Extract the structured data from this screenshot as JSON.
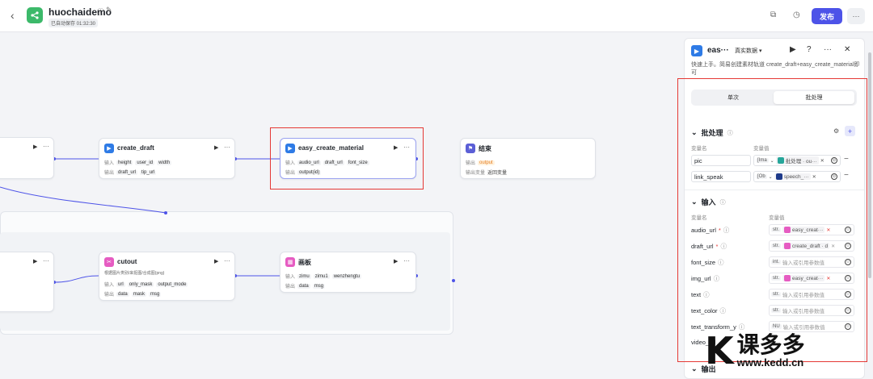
{
  "topbar": {
    "back_icon": "chevron-left-icon",
    "app_title": "huochaidemo",
    "autosave": "已自动保存 01:32:30",
    "publish_label": "发布",
    "more_label": "···"
  },
  "nodes": {
    "create_draft": {
      "title": "create_draft",
      "in_label": "输入",
      "inputs": [
        "height",
        "user_id",
        "width"
      ],
      "out_label": "输出",
      "outputs": [
        "draft_url",
        "tip_url"
      ]
    },
    "easy_create_material": {
      "title": "easy_create_material",
      "in_label": "输入",
      "inputs": [
        "audio_url",
        "draft_url",
        "font_size"
      ],
      "out_label": "输出",
      "outputs": [
        "output(id)"
      ]
    },
    "end": {
      "title": "结束",
      "out_label": "输出",
      "output": "output",
      "out_var_label": "输出变量",
      "out_var_value": "返回变量"
    },
    "cutout": {
      "title": "cutout",
      "desc": "根据图片类别/来抠图/合成图(png)",
      "in_label": "输入",
      "inputs": [
        "url",
        "only_mask",
        "output_mode"
      ],
      "out_label": "输出",
      "outputs": [
        "data",
        "mask",
        "msg"
      ]
    },
    "canvas": {
      "title": "画板",
      "in_label": "输入",
      "inputs": [
        "zimu",
        "zimu1",
        "wenzhengtu"
      ],
      "out_label": "输出",
      "outputs": [
        "data",
        "msg"
      ]
    }
  },
  "panel": {
    "title": "eas···",
    "mode": "真实数据 ▾",
    "desc": "快速上手。简易创建素材轨道 create_draft+easy_create_material即可",
    "tabs": [
      "单次",
      "批处理"
    ],
    "batch_title": "批处理",
    "col_var_name": "变量名",
    "col_var_value": "变量值",
    "batch_vars": [
      {
        "name": "pic",
        "type": "[Ima",
        "chip": "批处理 · ou···",
        "color": "#26a69a"
      },
      {
        "name": "link_speak",
        "type": "[Ob",
        "chip": "speech_···",
        "color": "#1e3a8a"
      }
    ],
    "input_title": "输入",
    "inputs": [
      {
        "name": "audio_url",
        "required": "*",
        "type": "str.",
        "chip": "easy_creat···",
        "placeholder": ""
      },
      {
        "name": "draft_url",
        "required": "*",
        "type": "str.",
        "chip": "create_draft · d",
        "placeholder": ""
      },
      {
        "name": "font_size",
        "required": "",
        "type": "int.",
        "chip": "",
        "placeholder": "输入或引用参数值"
      },
      {
        "name": "img_url",
        "required": "",
        "type": "str.",
        "chip": "easy_creat···",
        "placeholder": ""
      },
      {
        "name": "text",
        "required": "",
        "type": "str.",
        "chip": "",
        "placeholder": "输入或引用参数值"
      },
      {
        "name": "text_color",
        "required": "",
        "type": "str.",
        "chip": "",
        "placeholder": "输入或引用参数值"
      },
      {
        "name": "text_transform_y",
        "required": "",
        "type": "NU",
        "chip": "",
        "placeholder": "输入或引用参数值"
      },
      {
        "name": "video_url",
        "required": "",
        "type": "",
        "chip": "",
        "placeholder": ""
      }
    ],
    "output_title": "输出"
  },
  "watermark": {
    "cn": "课多多",
    "url": "www.kedd.cn"
  },
  "colors": {
    "accent": "#4d53e8",
    "highlight": "#e53935",
    "plugin_blue": "#2e7be6",
    "end_purple": "#5b5fd6",
    "cutout_pink": "#e65cc2"
  }
}
